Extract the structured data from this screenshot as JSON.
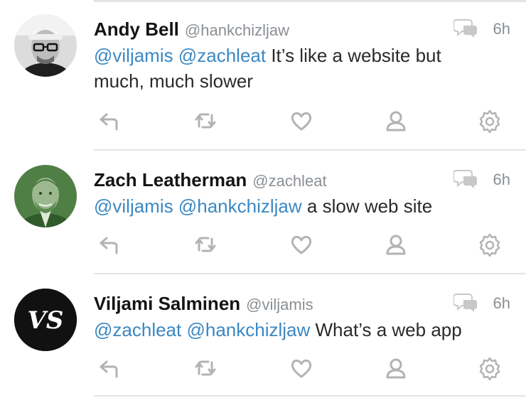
{
  "tweets": [
    {
      "name": "Andy Bell",
      "handle": "@hankchizljaw",
      "time": "6h",
      "mentions": [
        "@viljamis",
        "@zachleat"
      ],
      "text_line1_rest": " It’s like a website but",
      "text_line2": "much, much slower",
      "avatar": "andy-bell-avatar"
    },
    {
      "name": "Zach Leatherman",
      "handle": "@zachleat",
      "time": "6h",
      "mentions": [
        "@viljamis",
        "@hankchizljaw"
      ],
      "text_rest": " a slow web site",
      "avatar": "zach-leatherman-avatar"
    },
    {
      "name": "Viljami Salminen",
      "handle": "@viljamis",
      "time": "6h",
      "mentions": [
        "@zachleat",
        "@hankchizljaw"
      ],
      "text_rest": " What’s a web app",
      "avatar": "viljami-salminen-avatar",
      "avatar_monogram": "VS"
    }
  ],
  "icons": {
    "conversation": "conversation-icon",
    "reply": "reply-icon",
    "retweet": "retweet-icon",
    "like": "heart-icon",
    "user": "user-icon",
    "settings": "gear-icon"
  },
  "colors": {
    "mention": "#3b88c3",
    "muted": "#8a8f94",
    "icon": "#b3b3b3",
    "divider": "#e4e4e4"
  }
}
